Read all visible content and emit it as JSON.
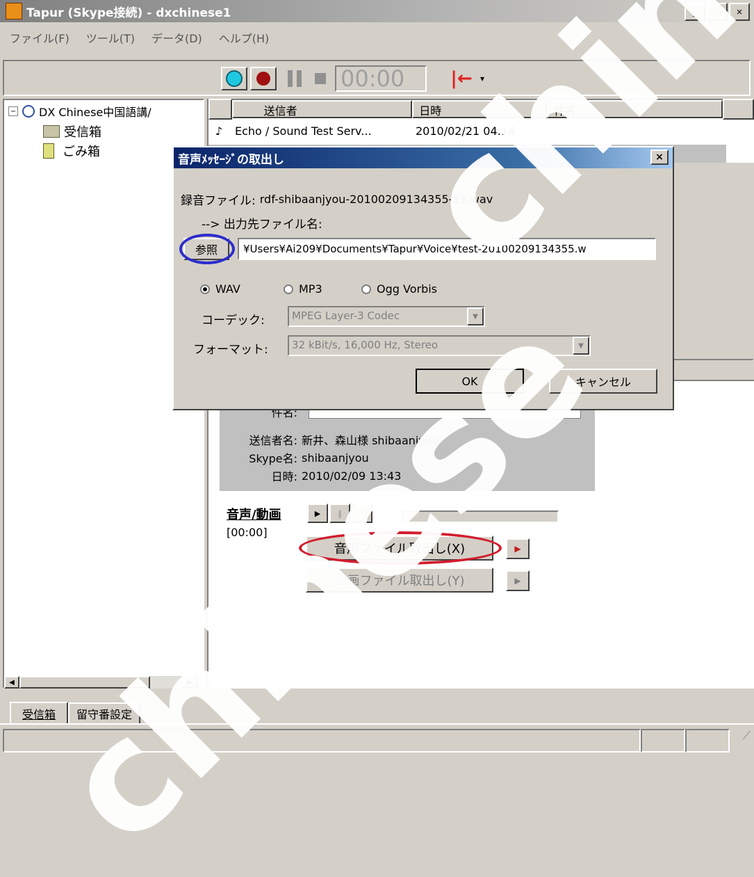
{
  "window": {
    "title": "Tapur (Skype接続) - dxchinese1",
    "min_icon": "minimize-icon",
    "max_icon": "maximize-icon",
    "close_icon": "close-icon"
  },
  "menu": [
    "ファイル(F)",
    "ツール(T)",
    "データ(D)",
    "ヘルプ(H)"
  ],
  "toolbar": {
    "time": "00:00"
  },
  "tree": {
    "root": "DX Chinese中国語講/",
    "inbox": "受信箱",
    "trash": "ごみ箱"
  },
  "list": {
    "columns": [
      "送信者",
      "日時",
      "件名"
    ],
    "rows": [
      {
        "sender": "Echo / Sound Test Serv...",
        "datetime": "2010/02/21 04:14",
        "subject": ""
      }
    ]
  },
  "detail": {
    "subject_label": "件名:",
    "sender_label": "送信者名:",
    "sender_value": "新井、森山様 shibaanjyou",
    "skype_label": "Skype名:",
    "skype_value": "shibaanjyou",
    "date_label": "日時:",
    "date_value": "2010/02/09 13:43",
    "media_title": "音声/動画",
    "media_time": "[00:00]",
    "extract_audio": "音声ファイル取出し(X)",
    "extract_video": "動画ファイル取出し(Y)"
  },
  "dialog": {
    "title": "音声ﾒｯｾｰｼﾞの取出し",
    "record_label": "録音ファイル:",
    "record_file": "rdf-shibaanjyou-20100209134355-$$.wav",
    "output_label": "--> 出力先ファイル名:",
    "browse": "参照",
    "path": "¥Users¥Ai209¥Documents¥Tapur¥Voice¥test-20100209134355.w",
    "formats": [
      "WAV",
      "MP3",
      "Ogg Vorbis"
    ],
    "codec_label": "コーデック:",
    "codec_value": "MPEG Layer-3 Codec",
    "format_label": "フォーマット:",
    "format_value": "32 kBit/s, 16,000 Hz, Stereo",
    "ok": "OK",
    "cancel": "キャンセル"
  },
  "tabs": [
    "受信箱",
    "留守番設定"
  ],
  "watermark": [
    "chinese",
    "chinese"
  ],
  "colors": {
    "titlebar": "#0a246a",
    "titlebar_end": "#a6caf0",
    "highlight_red": "#d21e2e",
    "highlight_blue": "#2d2dcc"
  }
}
